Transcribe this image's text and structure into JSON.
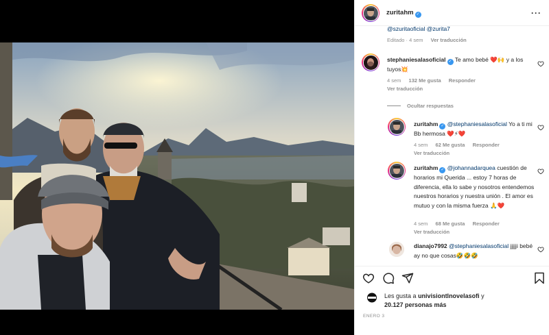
{
  "post": {
    "author": "zuritahm",
    "previous_caption": {
      "mentions": "@szuritaoficial @zurita7",
      "edited": "Editado · 4 sem",
      "translate": "Ver traducción"
    },
    "likes_prefix": "Les gusta a",
    "likes_user": "univisiontlnovelasofi",
    "likes_suffix": "y",
    "likes_count": "20.127 personas más",
    "date": "ENERO 3"
  },
  "comments": [
    {
      "username": "stephaniesalasoficial",
      "text": "Te amo bebé ❤️🙌 y a los tuyos💥",
      "age": "4 sem",
      "likes": "132 Me gusta",
      "reply": "Responder",
      "translate": "Ver traducción",
      "verified": true
    }
  ],
  "hide_replies": "Ocultar respuestas",
  "replies": [
    {
      "username": "zuritahm",
      "mention": "@stephaniesalasoficial",
      "text": "Yo a ti mi Bb hermosa ❤️⚡❤️",
      "age": "4 sem",
      "likes": "62 Me gusta",
      "reply": "Responder",
      "translate": "Ver traducción"
    },
    {
      "username": "zuritahm",
      "mention": "@johannadarquea",
      "text": "cuestión de horarios mi Querida ... estoy 7 horas de diferencia, ella lo sabe y nosotros entendemos nuestros horarios y nuestra unión . El amor es mutuo y con la misma fuerza 🙏❤️",
      "age": "4 sem",
      "likes": "68 Me gusta",
      "reply": "Responder",
      "translate": "Ver traducción"
    },
    {
      "username": "dianajo7992",
      "mention": "@stephaniesalasoficial",
      "text": "jjjjji bebé ay no que cosas🤣🤣🤣"
    }
  ],
  "icons": {
    "like": "heart-icon",
    "comment": "comment-icon",
    "share": "share-icon",
    "save": "bookmark-icon",
    "more": "more-icon"
  },
  "colors": {
    "verified": "#3897f0",
    "muted": "#8e8e8e",
    "mention": "#00376b"
  }
}
